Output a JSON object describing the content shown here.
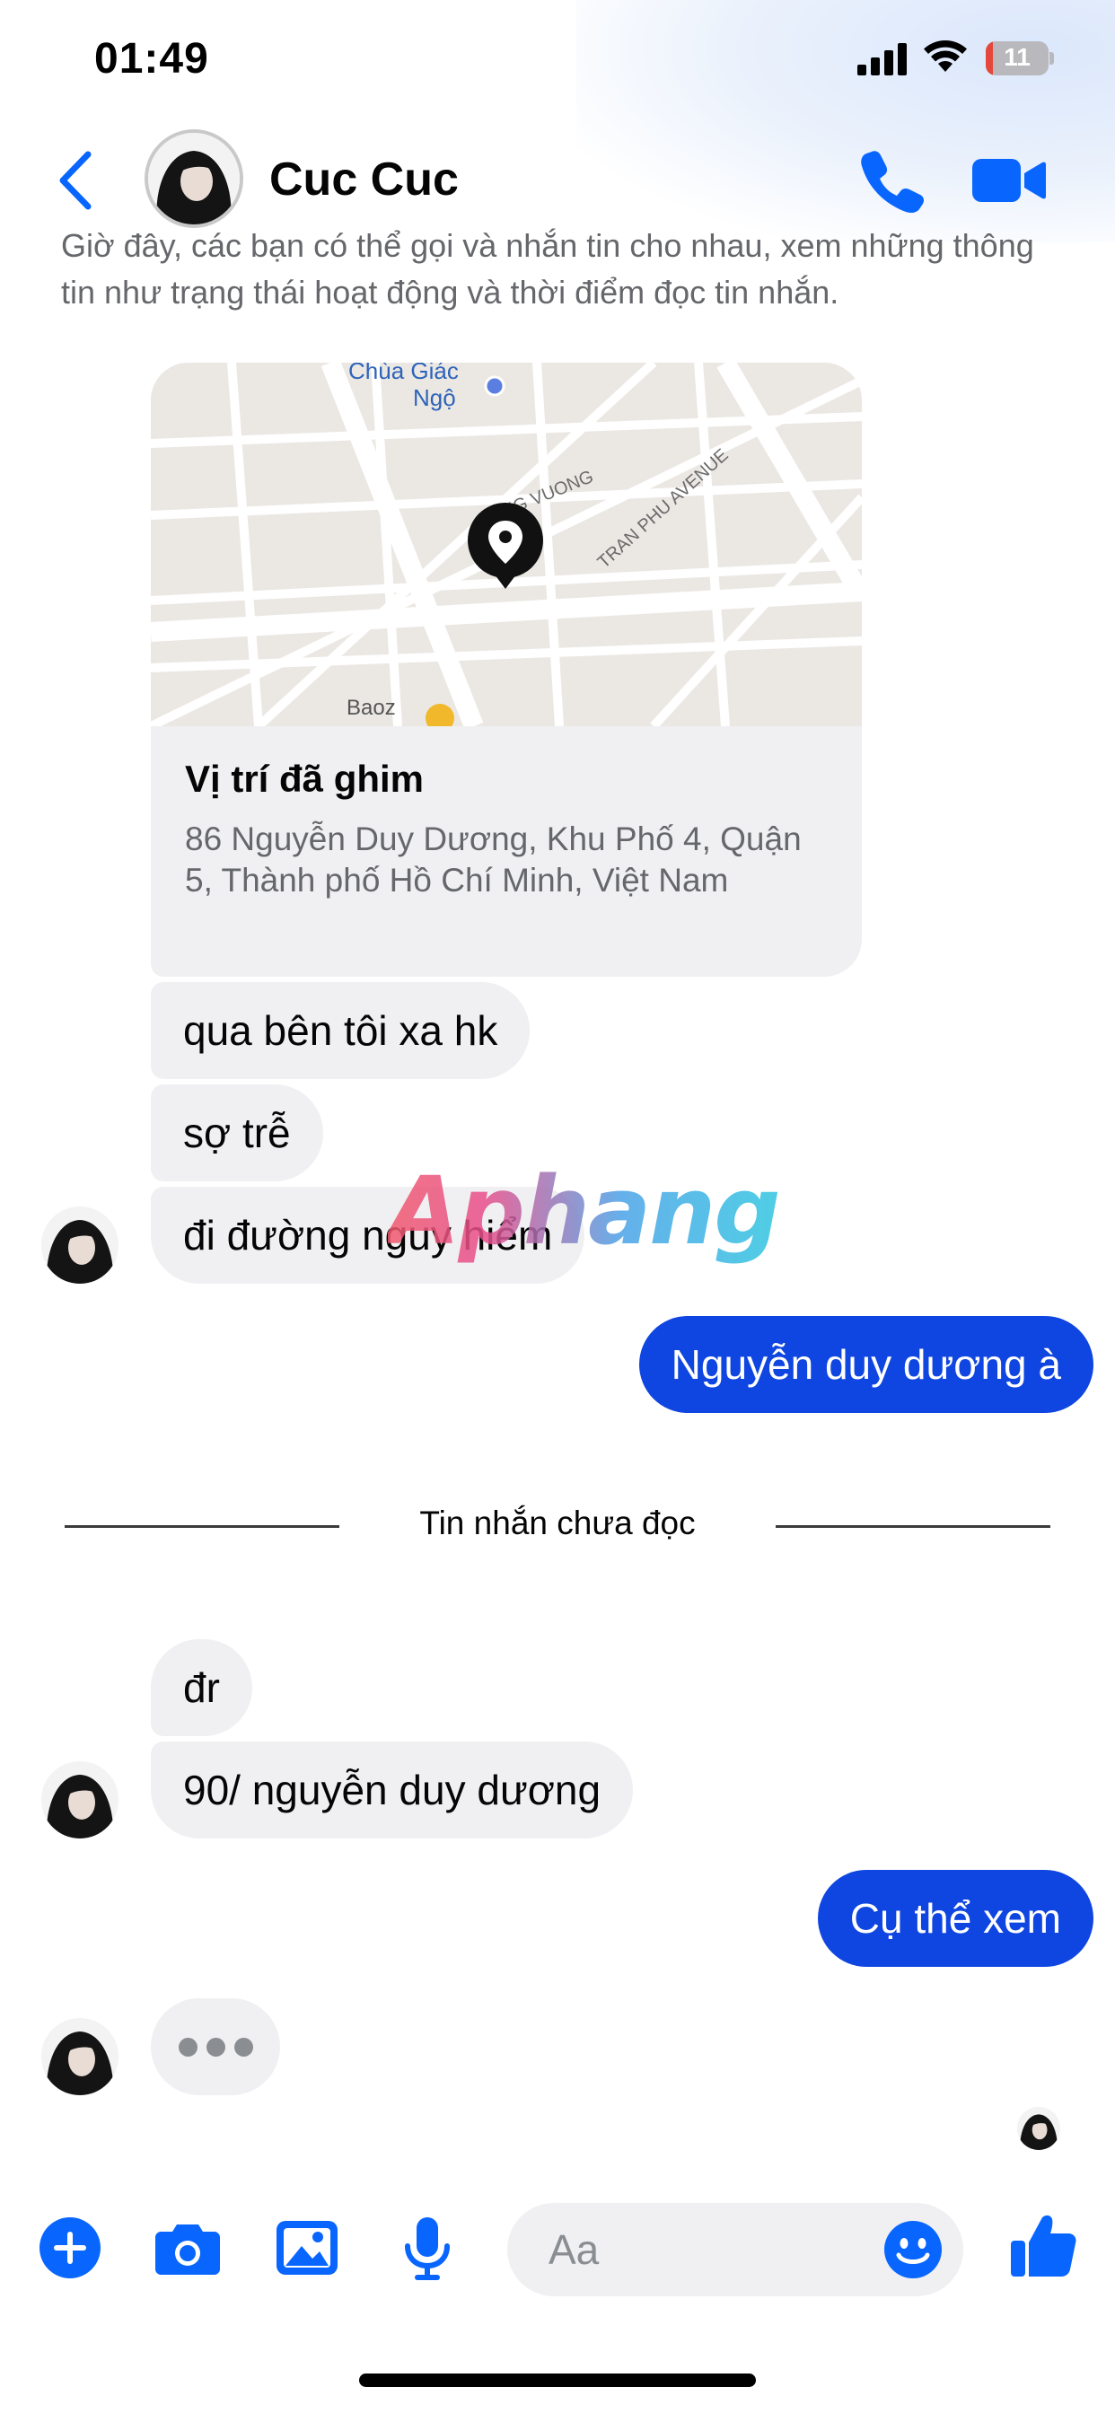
{
  "status_bar": {
    "time": "01:49",
    "battery": "11",
    "battery_level": 0.11
  },
  "header": {
    "contact_name": "Cuc Cuc"
  },
  "notice": "Giờ đây, các bạn có thể gọi và nhắn tin cho nhau, xem những thông tin như trạng thái hoạt động và thời điểm đọc tin nhắn.",
  "map_card": {
    "labels": [
      "Chùa Giác",
      "Ngộ",
      "UNG VUONG",
      "TRAN PHU AVENUE",
      "Baoz"
    ],
    "title": "Vị trí đã ghim",
    "address": "86 Nguyễn Duy Dương, Khu Phố 4, Quận 5, Thành phố Hồ Chí Minh, Việt Nam"
  },
  "messages": [
    {
      "from": "them",
      "text": "qua bên tôi xa hk"
    },
    {
      "from": "them",
      "text": "sợ trễ"
    },
    {
      "from": "them",
      "text": "đi đường nguy hiểm"
    },
    {
      "from": "me",
      "text": "Nguyễn duy dương à"
    },
    {
      "from": "them",
      "text": "đr"
    },
    {
      "from": "them",
      "text": "90/ nguyễn duy dương"
    },
    {
      "from": "me",
      "text": "Cụ thể xem"
    }
  ],
  "unread_divider": "Tin nhắn chưa đọc",
  "watermark": "Aphang",
  "composer": {
    "placeholder": "Aa"
  },
  "colors": {
    "accent": "#0866ff",
    "outgoing_bubble": "#0f45e0",
    "incoming_bubble": "#f0f0f2",
    "battery_low": "#e5483b"
  },
  "icons": [
    "back-chevron-icon",
    "phone-icon",
    "video-camera-icon",
    "location-pin-icon",
    "plus-circle-icon",
    "camera-icon",
    "image-icon",
    "microphone-icon",
    "smiley-icon",
    "thumbs-up-icon"
  ]
}
